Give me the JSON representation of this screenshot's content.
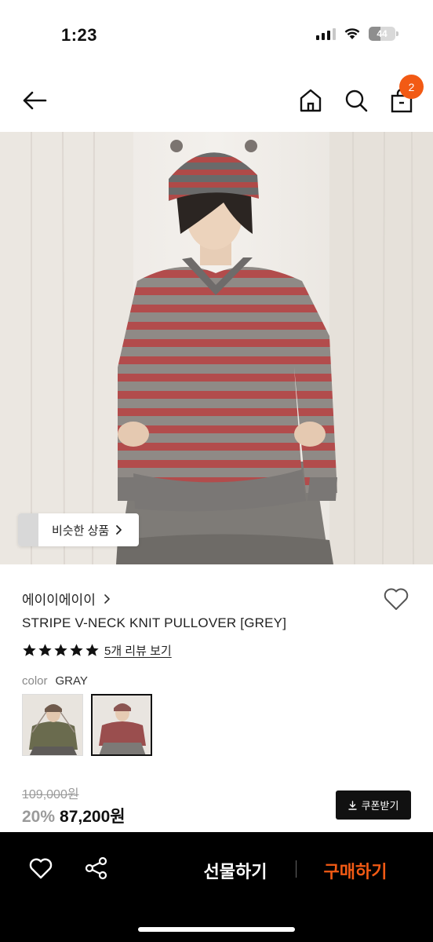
{
  "status_bar": {
    "time": "1:23",
    "battery_level": "44",
    "icons": [
      "signal-icon",
      "wifi-icon",
      "battery-icon"
    ]
  },
  "header": {
    "icons": [
      "back-arrow-icon",
      "home-icon",
      "search-icon",
      "shopping-bag-icon"
    ],
    "cart_count": "2",
    "badge_color": "#f25a14"
  },
  "product_image": {
    "similar_items_label": "비슷한 상품"
  },
  "product": {
    "brand": "에이이에이이",
    "name": "STRIPE V-NECK KNIT PULLOVER [GREY]",
    "rating": 5,
    "rating_max": 5,
    "review_link": "5개 리뷰 보기",
    "color_label": "color",
    "color_value": "GRAY",
    "swatches_count": 2,
    "selected_swatch": 2,
    "original_price": "109,000원",
    "discount": "20%",
    "sale_price": "87,200원",
    "coupon_label": "쿠폰받기"
  },
  "bottom_bar": {
    "gift_label": "선물하기",
    "buy_label": "구매하기",
    "accent_color": "#f25a14"
  }
}
